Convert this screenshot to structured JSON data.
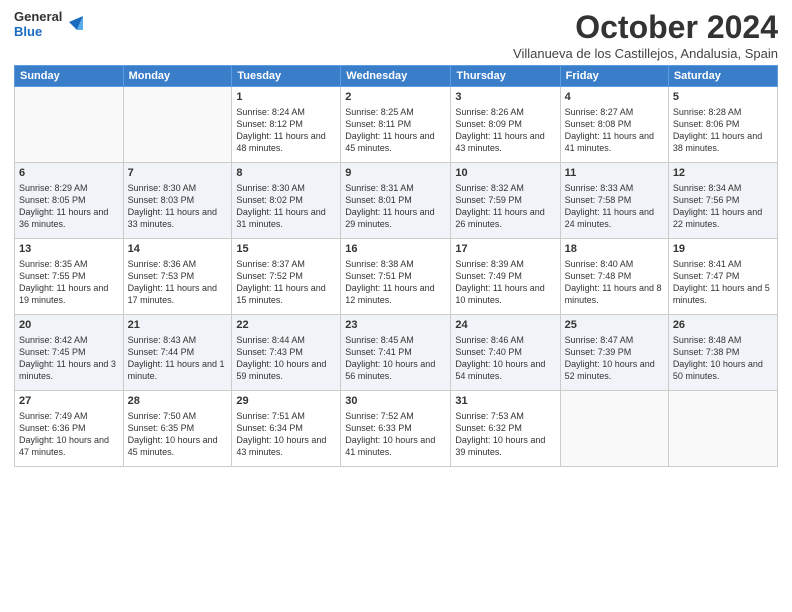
{
  "logo": {
    "line1": "General",
    "line2": "Blue"
  },
  "title": "October 2024",
  "subtitle": "Villanueva de los Castillejos, Andalusia, Spain",
  "days_of_week": [
    "Sunday",
    "Monday",
    "Tuesday",
    "Wednesday",
    "Thursday",
    "Friday",
    "Saturday"
  ],
  "weeks": [
    [
      {
        "day": "",
        "info": ""
      },
      {
        "day": "",
        "info": ""
      },
      {
        "day": "1",
        "info": "Sunrise: 8:24 AM\nSunset: 8:12 PM\nDaylight: 11 hours and 48 minutes."
      },
      {
        "day": "2",
        "info": "Sunrise: 8:25 AM\nSunset: 8:11 PM\nDaylight: 11 hours and 45 minutes."
      },
      {
        "day": "3",
        "info": "Sunrise: 8:26 AM\nSunset: 8:09 PM\nDaylight: 11 hours and 43 minutes."
      },
      {
        "day": "4",
        "info": "Sunrise: 8:27 AM\nSunset: 8:08 PM\nDaylight: 11 hours and 41 minutes."
      },
      {
        "day": "5",
        "info": "Sunrise: 8:28 AM\nSunset: 8:06 PM\nDaylight: 11 hours and 38 minutes."
      }
    ],
    [
      {
        "day": "6",
        "info": "Sunrise: 8:29 AM\nSunset: 8:05 PM\nDaylight: 11 hours and 36 minutes."
      },
      {
        "day": "7",
        "info": "Sunrise: 8:30 AM\nSunset: 8:03 PM\nDaylight: 11 hours and 33 minutes."
      },
      {
        "day": "8",
        "info": "Sunrise: 8:30 AM\nSunset: 8:02 PM\nDaylight: 11 hours and 31 minutes."
      },
      {
        "day": "9",
        "info": "Sunrise: 8:31 AM\nSunset: 8:01 PM\nDaylight: 11 hours and 29 minutes."
      },
      {
        "day": "10",
        "info": "Sunrise: 8:32 AM\nSunset: 7:59 PM\nDaylight: 11 hours and 26 minutes."
      },
      {
        "day": "11",
        "info": "Sunrise: 8:33 AM\nSunset: 7:58 PM\nDaylight: 11 hours and 24 minutes."
      },
      {
        "day": "12",
        "info": "Sunrise: 8:34 AM\nSunset: 7:56 PM\nDaylight: 11 hours and 22 minutes."
      }
    ],
    [
      {
        "day": "13",
        "info": "Sunrise: 8:35 AM\nSunset: 7:55 PM\nDaylight: 11 hours and 19 minutes."
      },
      {
        "day": "14",
        "info": "Sunrise: 8:36 AM\nSunset: 7:53 PM\nDaylight: 11 hours and 17 minutes."
      },
      {
        "day": "15",
        "info": "Sunrise: 8:37 AM\nSunset: 7:52 PM\nDaylight: 11 hours and 15 minutes."
      },
      {
        "day": "16",
        "info": "Sunrise: 8:38 AM\nSunset: 7:51 PM\nDaylight: 11 hours and 12 minutes."
      },
      {
        "day": "17",
        "info": "Sunrise: 8:39 AM\nSunset: 7:49 PM\nDaylight: 11 hours and 10 minutes."
      },
      {
        "day": "18",
        "info": "Sunrise: 8:40 AM\nSunset: 7:48 PM\nDaylight: 11 hours and 8 minutes."
      },
      {
        "day": "19",
        "info": "Sunrise: 8:41 AM\nSunset: 7:47 PM\nDaylight: 11 hours and 5 minutes."
      }
    ],
    [
      {
        "day": "20",
        "info": "Sunrise: 8:42 AM\nSunset: 7:45 PM\nDaylight: 11 hours and 3 minutes."
      },
      {
        "day": "21",
        "info": "Sunrise: 8:43 AM\nSunset: 7:44 PM\nDaylight: 11 hours and 1 minute."
      },
      {
        "day": "22",
        "info": "Sunrise: 8:44 AM\nSunset: 7:43 PM\nDaylight: 10 hours and 59 minutes."
      },
      {
        "day": "23",
        "info": "Sunrise: 8:45 AM\nSunset: 7:41 PM\nDaylight: 10 hours and 56 minutes."
      },
      {
        "day": "24",
        "info": "Sunrise: 8:46 AM\nSunset: 7:40 PM\nDaylight: 10 hours and 54 minutes."
      },
      {
        "day": "25",
        "info": "Sunrise: 8:47 AM\nSunset: 7:39 PM\nDaylight: 10 hours and 52 minutes."
      },
      {
        "day": "26",
        "info": "Sunrise: 8:48 AM\nSunset: 7:38 PM\nDaylight: 10 hours and 50 minutes."
      }
    ],
    [
      {
        "day": "27",
        "info": "Sunrise: 7:49 AM\nSunset: 6:36 PM\nDaylight: 10 hours and 47 minutes."
      },
      {
        "day": "28",
        "info": "Sunrise: 7:50 AM\nSunset: 6:35 PM\nDaylight: 10 hours and 45 minutes."
      },
      {
        "day": "29",
        "info": "Sunrise: 7:51 AM\nSunset: 6:34 PM\nDaylight: 10 hours and 43 minutes."
      },
      {
        "day": "30",
        "info": "Sunrise: 7:52 AM\nSunset: 6:33 PM\nDaylight: 10 hours and 41 minutes."
      },
      {
        "day": "31",
        "info": "Sunrise: 7:53 AM\nSunset: 6:32 PM\nDaylight: 10 hours and 39 minutes."
      },
      {
        "day": "",
        "info": ""
      },
      {
        "day": "",
        "info": ""
      }
    ]
  ]
}
